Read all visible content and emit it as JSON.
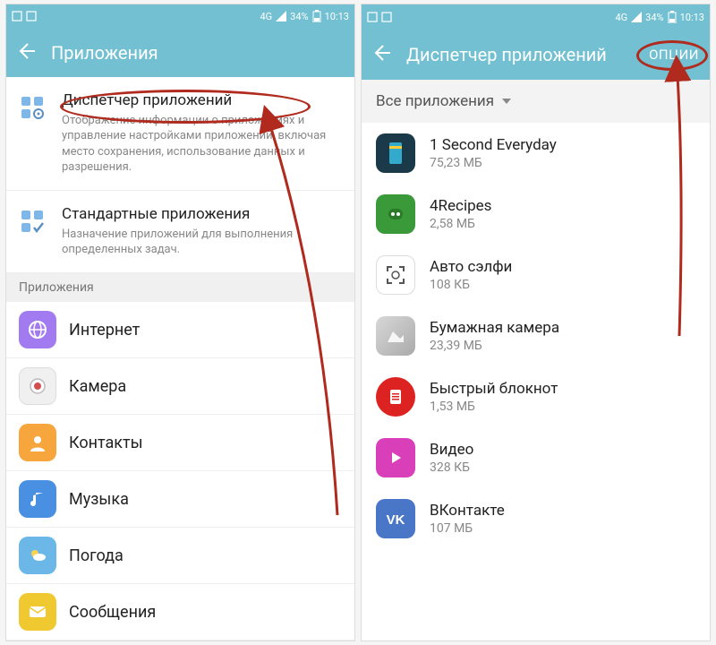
{
  "status": {
    "network": "4G",
    "battery": "34%",
    "time": "10:13"
  },
  "left": {
    "title": "Приложения",
    "item1": {
      "title": "Диспетчер приложений",
      "sub": "Отображение информации о приложениях и управление настройками приложений, включая место сохранения, использование данных и разрешения."
    },
    "item2": {
      "title": "Стандартные приложения",
      "sub": "Назначение приложений для выполнения определенных задач."
    },
    "section": "Приложения",
    "apps": {
      "a0": "Интернет",
      "a1": "Камера",
      "a2": "Контакты",
      "a3": "Музыка",
      "a4": "Погода",
      "a5": "Сообщения"
    }
  },
  "right": {
    "title": "Диспетчер приложений",
    "action": "ОПЦИИ",
    "filter": "Все приложения",
    "apps": {
      "r0": {
        "name": "1 Second Everyday",
        "size": "75,23 МБ"
      },
      "r1": {
        "name": "4Recipes",
        "size": "2,58 МБ"
      },
      "r2": {
        "name": "Авто сэлфи",
        "size": "108 КБ"
      },
      "r3": {
        "name": "Бумажная камера",
        "size": "23,39 МБ"
      },
      "r4": {
        "name": "Быстрый блокнот",
        "size": "1,53 МБ"
      },
      "r5": {
        "name": "Видео",
        "size": "328 КБ"
      },
      "r6": {
        "name": "ВКонтакте",
        "size": "107 МБ"
      }
    }
  }
}
